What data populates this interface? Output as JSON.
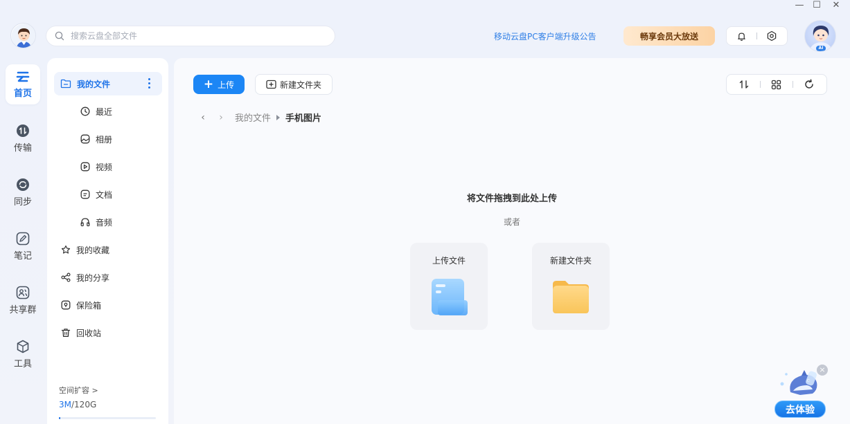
{
  "window": {
    "minimize": "—",
    "maximize": "☐",
    "close": "✕"
  },
  "header": {
    "search_placeholder": "搜索云盘全部文件",
    "notice_link": "移动云盘PC客户端升级公告",
    "vip_button": "畅享会员大放送",
    "notification_icon": "bell-icon",
    "settings_icon": "gear-icon",
    "ai_badge": "AI"
  },
  "rail": {
    "items": [
      {
        "label": "首页",
        "icon": "cloud-icon",
        "active": true
      },
      {
        "label": "传输",
        "icon": "transfer-icon"
      },
      {
        "label": "同步",
        "icon": "sync-icon"
      },
      {
        "label": "笔记",
        "icon": "note-icon"
      },
      {
        "label": "共享群",
        "icon": "group-icon"
      },
      {
        "label": "工具",
        "icon": "cube-icon"
      }
    ]
  },
  "sidebar": {
    "my_files": "我的文件",
    "items": [
      {
        "label": "最近",
        "icon": "clock-icon"
      },
      {
        "label": "相册",
        "icon": "album-icon"
      },
      {
        "label": "视频",
        "icon": "video-icon"
      },
      {
        "label": "文档",
        "icon": "document-icon"
      },
      {
        "label": "音频",
        "icon": "headphones-icon"
      }
    ],
    "favorites": "我的收藏",
    "shares": "我的分享",
    "vault": "保险箱",
    "recycle": "回收站",
    "storage_expand": "空间扩容 >",
    "storage_used": "3M",
    "storage_total": "/120G",
    "storage_fraction": 2.5e-05
  },
  "toolbar": {
    "upload_label": "上传",
    "new_folder_label": "新建文件夹",
    "sort_icon": "sort-icon",
    "grid_icon": "grid-icon",
    "refresh_icon": "refresh-icon"
  },
  "breadcrumb": {
    "parent": "我的文件",
    "current": "手机图片"
  },
  "empty": {
    "title": "将文件拖拽到此处上传",
    "or": "或者",
    "upload_card": "上传文件",
    "new_folder_card": "新建文件夹"
  },
  "promo": {
    "button": "去体验",
    "close": "×"
  }
}
